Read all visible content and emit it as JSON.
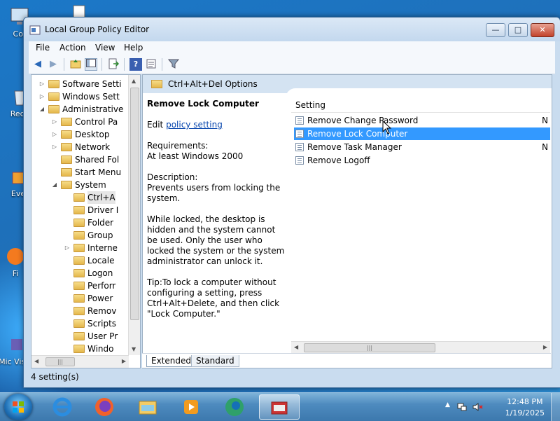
{
  "window": {
    "title": "Local Group Policy Editor",
    "controls": {
      "minimize": "—",
      "maximize": "□",
      "close": "✕"
    }
  },
  "menu": [
    "File",
    "Action",
    "View",
    "Help"
  ],
  "toolbar": {
    "icons": [
      "back-icon",
      "forward-icon",
      "up-folder-icon",
      "show-hide-tree-icon",
      "export-list-icon",
      "help-icon",
      "properties-icon",
      "filter-icon"
    ]
  },
  "tree": {
    "items": [
      {
        "label": "Software Setti",
        "arrow": "▷"
      },
      {
        "label": "Windows Sett",
        "arrow": "▷"
      },
      {
        "label": "Administrative",
        "arrow": "◢"
      },
      {
        "label": "Control Pa",
        "arrow": "▷"
      },
      {
        "label": "Desktop",
        "arrow": "▷"
      },
      {
        "label": "Network",
        "arrow": "▷"
      },
      {
        "label": "Shared Fol",
        "arrow": ""
      },
      {
        "label": "Start Menu",
        "arrow": ""
      },
      {
        "label": "System",
        "arrow": "◢"
      },
      {
        "label": "Ctrl+A",
        "arrow": ""
      },
      {
        "label": "Driver I",
        "arrow": ""
      },
      {
        "label": "Folder",
        "arrow": ""
      },
      {
        "label": "Group",
        "arrow": ""
      },
      {
        "label": "Interne",
        "arrow": "▷"
      },
      {
        "label": "Locale",
        "arrow": ""
      },
      {
        "label": "Logon",
        "arrow": ""
      },
      {
        "label": "Perforr",
        "arrow": ""
      },
      {
        "label": "Power",
        "arrow": ""
      },
      {
        "label": "Remov",
        "arrow": ""
      },
      {
        "label": "Scripts",
        "arrow": ""
      },
      {
        "label": "User Pr",
        "arrow": ""
      },
      {
        "label": "Windo",
        "arrow": ""
      }
    ]
  },
  "pane": {
    "header": "Ctrl+Alt+Del Options",
    "desc_title": "Remove Lock Computer",
    "edit_prefix": "Edit",
    "edit_link": "policy setting",
    "requirements_label": "Requirements:",
    "requirements_value": "At least Windows 2000",
    "description_label": "Description:",
    "description_1": "Prevents users from locking the system.",
    "description_2": "While locked, the desktop is hidden and the system cannot be used. Only the user who locked the system or the system administrator can unlock it.",
    "tip": "Tip:To lock a computer without configuring a setting, press Ctrl+Alt+Delete, and then click \"Lock Computer.\""
  },
  "list": {
    "column_header": "Setting",
    "rows": [
      {
        "label": "Remove Change Password",
        "state": "N"
      },
      {
        "label": "Remove Lock Computer",
        "state": ""
      },
      {
        "label": "Remove Task Manager",
        "state": "N"
      },
      {
        "label": "Remove Logoff",
        "state": ""
      }
    ],
    "selected_index": 1
  },
  "tabs": [
    {
      "label": "Extended"
    },
    {
      "label": "Standard"
    }
  ],
  "status": "4 setting(s)",
  "desktop_icons": [
    "Cor",
    "Recy",
    "Eve",
    "Fi",
    "Mic Visua"
  ],
  "taskbar": {
    "apps": [
      "internet-explorer-icon",
      "firefox-icon",
      "file-explorer-icon",
      "media-player-icon",
      "edge-icon",
      "group-policy-icon"
    ],
    "clock_time": "12:48 PM",
    "clock_date": "1/19/2025",
    "tray_arrow": "▲"
  }
}
